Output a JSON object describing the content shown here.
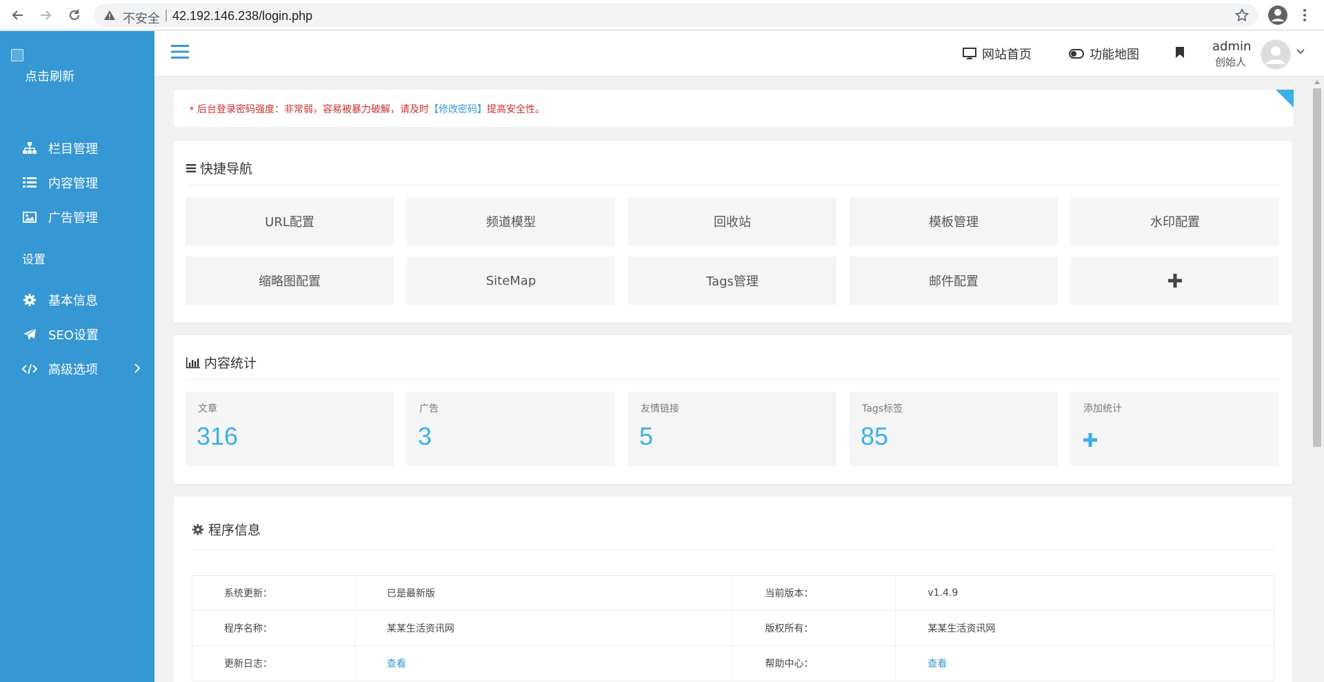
{
  "browser": {
    "insecure_label": "不安全",
    "separator": "|",
    "url": "42.192.146.238/login.php"
  },
  "sidebar": {
    "logo_text": "点击刷新",
    "items": [
      {
        "label": "栏目管理",
        "icon": "sitemap-icon"
      },
      {
        "label": "内容管理",
        "icon": "list-icon"
      },
      {
        "label": "广告管理",
        "icon": "image-icon"
      }
    ],
    "section_label": "设置",
    "settings_items": [
      {
        "label": "基本信息",
        "icon": "gear-icon"
      },
      {
        "label": "SEO设置",
        "icon": "paper-plane-icon"
      },
      {
        "label": "高级选项",
        "icon": "code-icon"
      }
    ]
  },
  "header": {
    "site_home": "网站首页",
    "feature_map": "功能地图",
    "user_name": "admin",
    "user_role": "创始人"
  },
  "alert": {
    "prefix": "后台登录密码强度：非常弱，容易被暴力破解，请及时",
    "link": "【修改密码】",
    "suffix": "提高安全性。"
  },
  "quick_nav": {
    "title": "快捷导航",
    "tiles": [
      "URL配置",
      "频道模型",
      "回收站",
      "模板管理",
      "水印配置",
      "缩略图配置",
      "SiteMap",
      "Tags管理",
      "邮件配置"
    ]
  },
  "stats": {
    "title": "内容统计",
    "items": [
      {
        "label": "文章",
        "value": "316"
      },
      {
        "label": "广告",
        "value": "3"
      },
      {
        "label": "友情链接",
        "value": "5"
      },
      {
        "label": "Tags标签",
        "value": "85"
      }
    ],
    "add_label": "添加统计"
  },
  "program_info": {
    "title": "程序信息",
    "rows": [
      {
        "k1": "系统更新：",
        "v1": "已是最新版",
        "k2": "当前版本：",
        "v2": "v1.4.9"
      },
      {
        "k1": "程序名称：",
        "v1": "某某生活资讯网",
        "k2": "版权所有：",
        "v2": "某某生活资讯网"
      },
      {
        "k1": "更新日志：",
        "v1": "查看",
        "k2": "帮助中心：",
        "v2": "查看"
      }
    ]
  },
  "colors": {
    "sidebar": "#3597d3",
    "accent": "#3ab0e8",
    "alert_text": "#c9302c"
  }
}
